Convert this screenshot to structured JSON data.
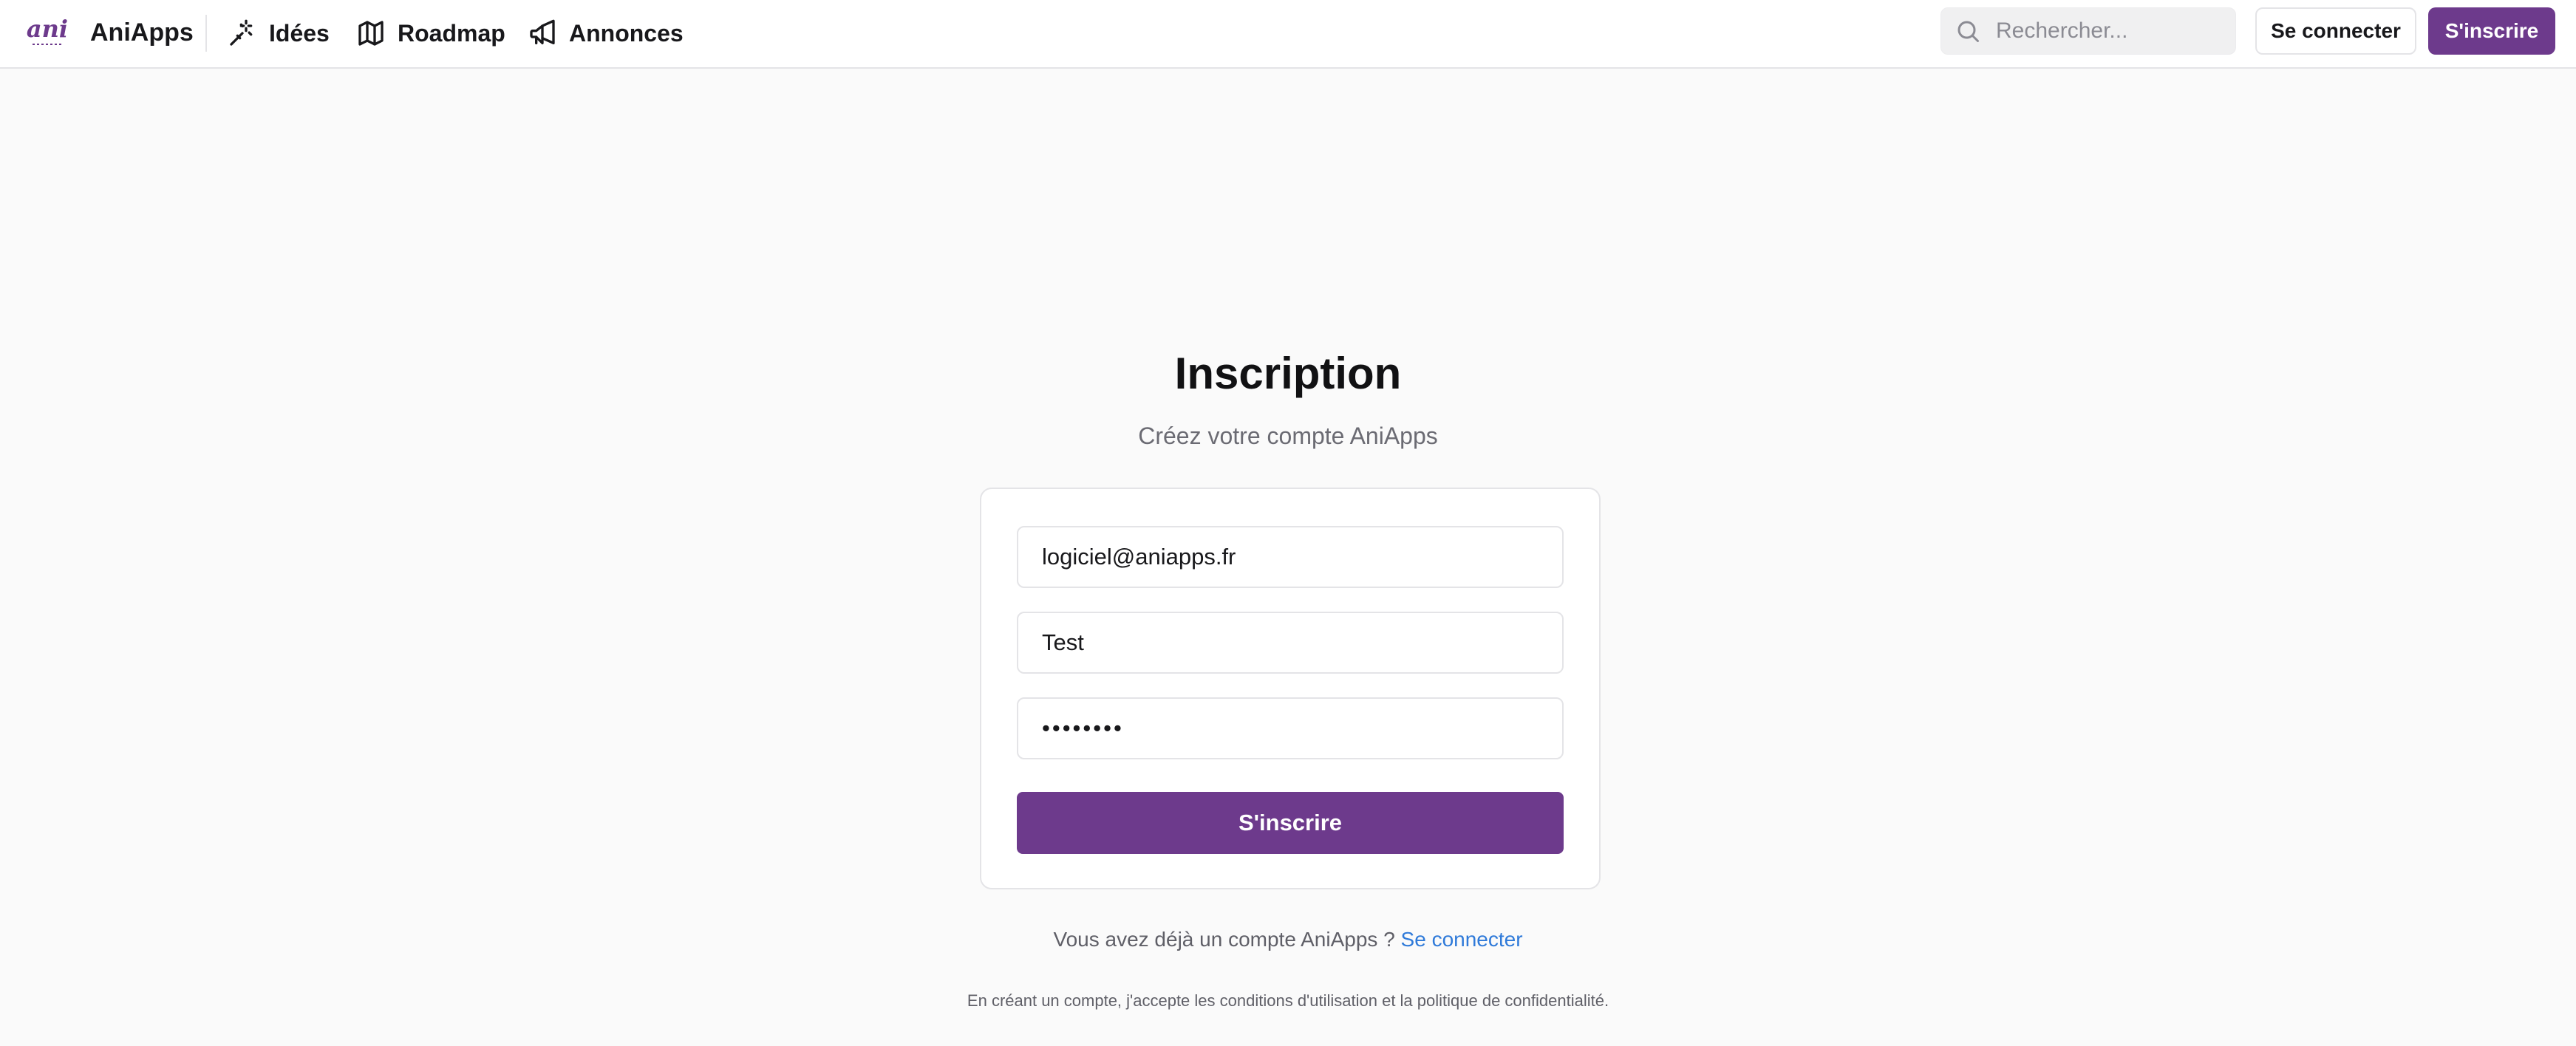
{
  "header": {
    "brand": "AniApps",
    "logo_text": "ani",
    "nav": [
      {
        "label": "Idées",
        "icon": "magic-wand-icon"
      },
      {
        "label": "Roadmap",
        "icon": "map-icon"
      },
      {
        "label": "Annonces",
        "icon": "megaphone-icon"
      }
    ],
    "search": {
      "placeholder": "Rechercher...",
      "value": ""
    },
    "login_label": "Se connecter",
    "signup_label": "S'inscrire"
  },
  "main": {
    "title": "Inscription",
    "subtitle": "Créez votre compte AniApps",
    "form": {
      "email_value": "logiciel@aniapps.fr",
      "name_value": "Test",
      "password_value": "••••••••",
      "submit_label": "S'inscrire"
    },
    "footer": {
      "prompt": "Vous avez déjà un compte AniApps ? ",
      "login_link": "Se connecter",
      "terms": "En créant un compte, j'accepte les conditions d'utilisation et la politique de confidentialité."
    }
  },
  "colors": {
    "accent": "#6d3a8c",
    "link": "#2f7ad9",
    "background": "#fafafa"
  }
}
